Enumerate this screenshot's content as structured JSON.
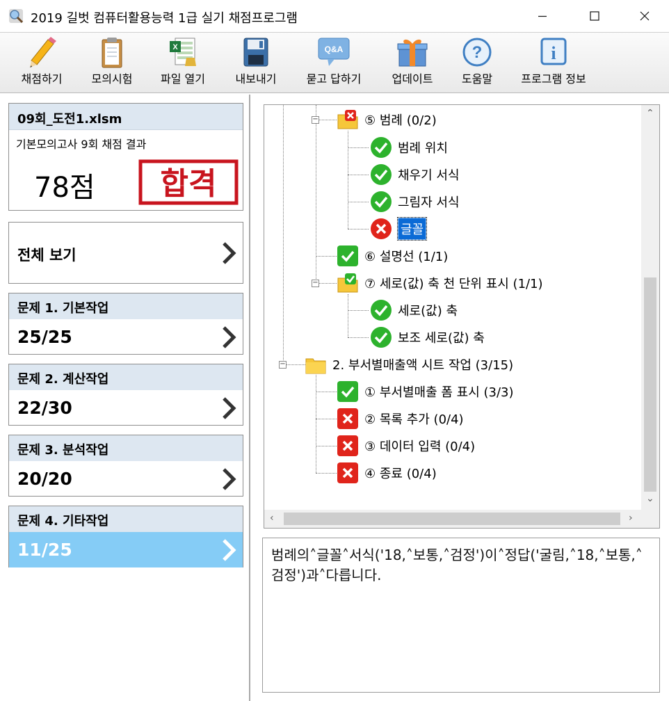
{
  "window": {
    "title": "2019 길벗 컴퓨터활용능력 1급 실기 채점프로그램",
    "controls": {
      "minimize": "—",
      "maximize": "☐",
      "close": "✕"
    }
  },
  "toolbar": {
    "items": [
      {
        "label": "채점하기",
        "icon": "pencil-icon"
      },
      {
        "label": "모의시험",
        "icon": "clipboard-icon"
      },
      {
        "label": "파일 열기",
        "icon": "excel-file-icon"
      },
      {
        "label": "내보내기",
        "icon": "floppy-disk-icon"
      },
      {
        "label": "묻고 답하기",
        "icon": "qa-bubble-icon"
      },
      {
        "label": "업데이트",
        "icon": "gift-icon"
      },
      {
        "label": "도움말",
        "icon": "help-icon"
      },
      {
        "label": "프로그램 정보",
        "icon": "info-icon"
      }
    ],
    "qa_icon_text": "Q&A"
  },
  "summary": {
    "file_name": "09회_도전1.xlsm",
    "description": "기본모의고사 9회 채점 결과",
    "score": "78점",
    "stamp_text": "합격",
    "view_all": "전체 보기"
  },
  "sections": [
    {
      "title": "문제 1. 기본작업",
      "score": "25/25",
      "active": false
    },
    {
      "title": "문제 2. 계산작업",
      "score": "22/30",
      "active": false
    },
    {
      "title": "문제 3. 분석작업",
      "score": "20/20",
      "active": false
    },
    {
      "title": "문제 4. 기타작업",
      "score": "11/25",
      "active": true
    }
  ],
  "tree": {
    "items": [
      {
        "text": "⑤ 범례 (0/2)",
        "icon": "folder-fail-icon",
        "level": 1,
        "selected": false
      },
      {
        "text": "범례 위치",
        "icon": "check-circle-icon",
        "level": 2,
        "selected": false
      },
      {
        "text": "채우기 서식",
        "icon": "check-circle-icon",
        "level": 2,
        "selected": false
      },
      {
        "text": "그림자 서식",
        "icon": "check-circle-icon",
        "level": 2,
        "selected": false
      },
      {
        "text": "글꼴",
        "icon": "x-circle-icon",
        "level": 2,
        "selected": true
      },
      {
        "text": "⑥ 설명선 (1/1)",
        "icon": "check-square-icon",
        "level": 1,
        "selected": false
      },
      {
        "text": "⑦ 세로(값) 축 천 단위 표시 (1/1)",
        "icon": "folder-pass-icon",
        "level": 1,
        "selected": false
      },
      {
        "text": "세로(값) 축",
        "icon": "check-circle-icon",
        "level": 2,
        "selected": false
      },
      {
        "text": "보조 세로(값) 축",
        "icon": "check-circle-icon",
        "level": 2,
        "selected": false
      },
      {
        "text": "2. 부서별매출액 시트 작업 (3/15)",
        "icon": "folder-icon",
        "level": 0,
        "selected": false
      },
      {
        "text": "① 부서별매출 폼 표시 (3/3)",
        "icon": "check-square-icon",
        "level": 1,
        "selected": false
      },
      {
        "text": "② 목록 추가 (0/4)",
        "icon": "x-square-icon",
        "level": 1,
        "selected": false
      },
      {
        "text": "③ 데이터 입력 (0/4)",
        "icon": "x-square-icon",
        "level": 1,
        "selected": false
      },
      {
        "text": "④ 종료 (0/4)",
        "icon": "x-square-icon",
        "level": 1,
        "selected": false
      }
    ]
  },
  "message": {
    "text": "범례의˄글꼴˄서식('18,˄보통,˄검정')이˄정답('굴림,˄18,˄보통,˄검정')과˄다릅니다."
  },
  "colors": {
    "header_bg": "#dde7f1",
    "active_bg": "#85ccf6",
    "pass_green": "#2db22d",
    "fail_red": "#e0241b",
    "stamp_red": "#c8141e",
    "selection_blue": "#0b6bd6"
  }
}
